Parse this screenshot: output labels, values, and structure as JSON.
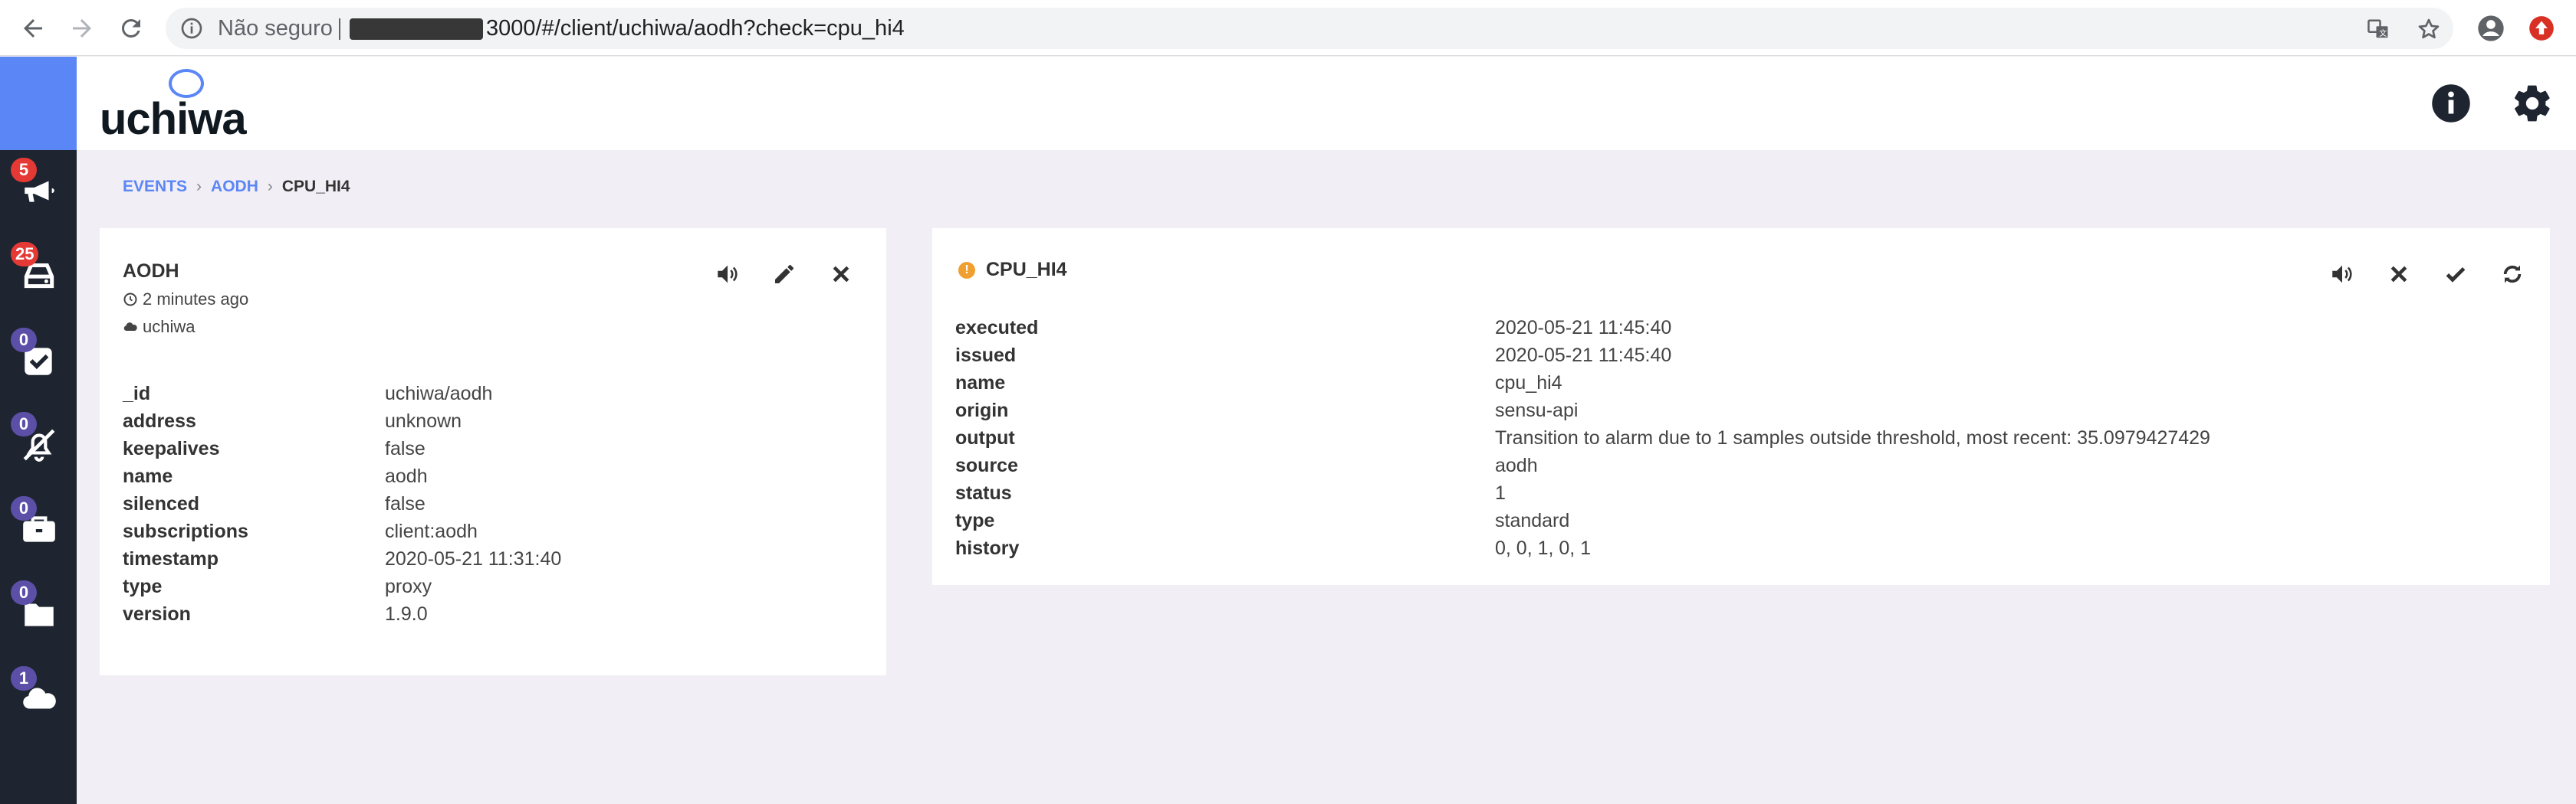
{
  "browser": {
    "security_status": "Não seguro",
    "url": "3000/#/client/uchiwa/aodh?check=cpu_hi4"
  },
  "app": {
    "logo_text": "uchiwa",
    "brand_color": "#5b86f6"
  },
  "sidebar": {
    "items": [
      {
        "icon": "megaphone-icon",
        "badge": "5",
        "badge_color": "#e53935"
      },
      {
        "icon": "inbox-icon",
        "badge": "25",
        "badge_color": "#e53935"
      },
      {
        "icon": "check-square-icon",
        "badge": "0",
        "badge_color": "#5b4fa8"
      },
      {
        "icon": "bell-slash-icon",
        "badge": "0",
        "badge_color": "#5b4fa8"
      },
      {
        "icon": "briefcase-icon",
        "badge": "0",
        "badge_color": "#5b4fa8"
      },
      {
        "icon": "folder-icon",
        "badge": "0",
        "badge_color": "#5b4fa8"
      },
      {
        "icon": "cloud-icon",
        "badge": "1",
        "badge_color": "#5b4fa8"
      }
    ]
  },
  "breadcrumb": {
    "items": [
      "EVENTS",
      "AODH"
    ],
    "current": "CPU_HI4"
  },
  "client_card": {
    "title": "AODH",
    "time_ago": "2 minutes ago",
    "datacenter": "uchiwa",
    "rows": [
      {
        "key": "_id",
        "value": "uchiwa/aodh"
      },
      {
        "key": "address",
        "value": "unknown"
      },
      {
        "key": "keepalives",
        "value": "false"
      },
      {
        "key": "name",
        "value": "aodh"
      },
      {
        "key": "silenced",
        "value": "false"
      },
      {
        "key": "subscriptions",
        "value": "client:aodh"
      },
      {
        "key": "timestamp",
        "value": "2020-05-21 11:31:40"
      },
      {
        "key": "type",
        "value": "proxy"
      },
      {
        "key": "version",
        "value": "1.9.0"
      }
    ]
  },
  "check_card": {
    "title": "CPU_HI4",
    "status_color": "#f0a030",
    "rows": [
      {
        "key": "executed",
        "value": "2020-05-21 11:45:40"
      },
      {
        "key": "issued",
        "value": "2020-05-21 11:45:40"
      },
      {
        "key": "name",
        "value": "cpu_hi4"
      },
      {
        "key": "origin",
        "value": "sensu-api"
      },
      {
        "key": "output",
        "value": "Transition to alarm due to 1 samples outside threshold, most recent: 35.0979427429"
      },
      {
        "key": "source",
        "value": "aodh"
      },
      {
        "key": "status",
        "value": "1"
      },
      {
        "key": "type",
        "value": "standard"
      },
      {
        "key": "history",
        "value": "0, 0, 1, 0, 1"
      }
    ]
  }
}
